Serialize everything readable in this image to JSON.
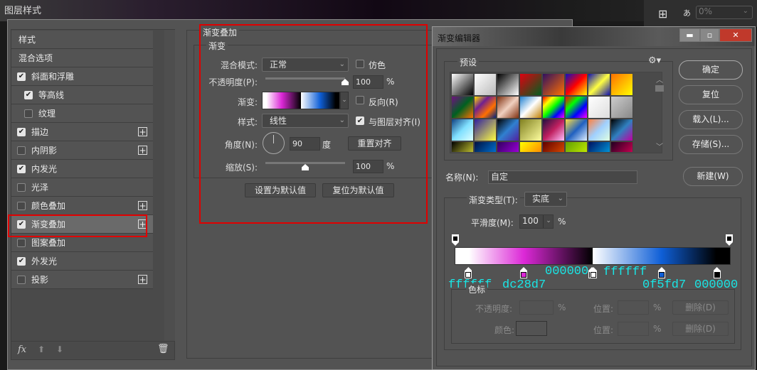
{
  "layer_style": {
    "title": "图层样式",
    "list_items": [
      {
        "label": "样式",
        "checkbox": null,
        "plus": false
      },
      {
        "label": "混合选项",
        "checkbox": null,
        "plus": false
      },
      {
        "label": "斜面和浮雕",
        "checkbox": true,
        "plus": false
      },
      {
        "label": "等高线",
        "checkbox": true,
        "plus": false,
        "indent": true
      },
      {
        "label": "纹理",
        "checkbox": false,
        "plus": false,
        "indent": true
      },
      {
        "label": "描边",
        "checkbox": true,
        "plus": true
      },
      {
        "label": "内阴影",
        "checkbox": false,
        "plus": true
      },
      {
        "label": "内发光",
        "checkbox": true,
        "plus": false
      },
      {
        "label": "光泽",
        "checkbox": false,
        "plus": false
      },
      {
        "label": "颜色叠加",
        "checkbox": false,
        "plus": true
      },
      {
        "label": "渐变叠加",
        "checkbox": true,
        "plus": true,
        "selected": true
      },
      {
        "label": "图案叠加",
        "checkbox": false,
        "plus": false
      },
      {
        "label": "外发光",
        "checkbox": true,
        "plus": false
      },
      {
        "label": "投影",
        "checkbox": false,
        "plus": true
      }
    ],
    "footer": {
      "fx": "fx"
    },
    "panel": {
      "section_title": "渐变叠加",
      "group_title": "渐变",
      "blend_mode_label": "混合模式:",
      "blend_mode_value": "正常",
      "dither_label": "仿色",
      "opacity_label": "不透明度(P):",
      "opacity_value": "100",
      "opacity_percent": 100,
      "percent": "%",
      "gradient_label": "渐变:",
      "reverse_label": "反向(R)",
      "style_label": "样式:",
      "style_value": "线性",
      "align_label": "与图层对齐(I)",
      "angle_label": "角度(N):",
      "angle_value": "90",
      "degree": "度",
      "reset_align": "重置对齐",
      "scale_label": "缩放(S):",
      "scale_value": "100",
      "scale_fraction": 0.5,
      "set_default": "设置为默认值",
      "reset_default": "复位为默认值"
    }
  },
  "top_right": {
    "value": "0%"
  },
  "gradient_editor": {
    "title": "渐变编辑器",
    "presets_label": "预设",
    "buttons": {
      "ok": "确定",
      "reset": "复位",
      "load": "载入(L)...",
      "save": "存储(S)...",
      "new": "新建(W)"
    },
    "name_label": "名称(N):",
    "name_value": "自定",
    "type_label": "渐变类型(T):",
    "type_value": "实底",
    "smooth_label": "平滑度(M):",
    "smooth_value": "100",
    "percent": "%",
    "stops_group": "色标",
    "opacity_label": "不透明度:",
    "location_label": "位置:",
    "color_label": "颜色:",
    "delete_label": "删除(D)",
    "color_stops": [
      {
        "color": "#ffffff",
        "location": 5,
        "label": "ffffff"
      },
      {
        "color": "#dc28d7",
        "location": 25,
        "label": "dc28d7"
      },
      {
        "color": "#000000",
        "location": 50,
        "label": "000000"
      },
      {
        "color": "#ffffff",
        "location": 50,
        "label": "ffffff"
      },
      {
        "color": "#0f5fd7",
        "location": 75,
        "label": "0f5fd7"
      },
      {
        "color": "#000000",
        "location": 95,
        "label": "000000"
      }
    ],
    "presets": [
      [
        "#ffffff",
        "#000000"
      ],
      [
        "#ffffff",
        "#bbbbbb"
      ],
      [
        "#000000",
        "#ffffff"
      ],
      [
        "#e00010",
        "#006020"
      ],
      [
        "#301060",
        "#ff7000"
      ],
      [
        "#1010c0",
        "#ff0000",
        "#ffff00"
      ],
      [
        "#1010b0",
        "#ffff40",
        "#1010b0"
      ],
      [
        "#ff7000",
        "#ffff00"
      ],
      [
        "#701080",
        "#006020",
        "#ff7000"
      ],
      [
        "#ffe000",
        "#702090",
        "#ff7000",
        "#002080"
      ],
      [
        "#803010",
        "#f0d0c0",
        "#803010"
      ],
      [
        "#2080d0",
        "#ffffff",
        "#c08000"
      ],
      [
        "#ff0000",
        "#ffff00",
        "#00ff00",
        "#0000ff",
        "#ff00ff"
      ],
      [
        "#ff0000",
        "#00ff00",
        "#0000ff",
        "#ff00ff"
      ],
      [
        "#ffffff",
        "#dddddd"
      ],
      [
        "#cccccc",
        "#888888"
      ],
      [
        "#104080",
        "#80e0ff",
        "#e0ffff"
      ],
      [
        "#3020a0",
        "#ffff40"
      ],
      [
        "#000000",
        "#3080d0",
        "#5020a0"
      ],
      [
        "#808020",
        "#ffffa0"
      ],
      [
        "#201040",
        "#c02060",
        "#ffc0ff"
      ],
      [
        "#ffe040",
        "#2060c0",
        "#e0f0ff"
      ],
      [
        "#ff8040",
        "#a0d0ff",
        "#e0ffe0"
      ],
      [
        "#000000",
        "#3080c0",
        "#c000a0"
      ],
      [
        "#000000",
        "#ffff40"
      ],
      [
        "#001040",
        "#0090ff"
      ],
      [
        "#300060",
        "#c000ff"
      ],
      [
        "#ffff00",
        "#ff6000"
      ],
      [
        "#600000",
        "#ff6000"
      ],
      [
        "#60a000",
        "#e0ff00"
      ],
      [
        "#001060",
        "#00c0ff"
      ],
      [
        "#200020",
        "#ff0060"
      ]
    ]
  }
}
